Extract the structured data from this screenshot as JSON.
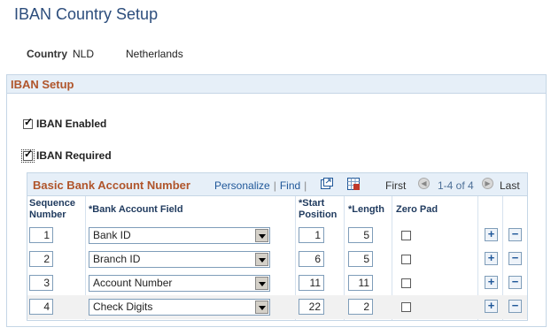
{
  "page": {
    "title": "IBAN Country Setup"
  },
  "country": {
    "label": "Country",
    "code": "NLD",
    "name": "Netherlands"
  },
  "iban_setup": {
    "title": "IBAN Setup",
    "iban_enabled": {
      "label": "IBAN Enabled",
      "checked": true
    },
    "iban_required": {
      "label": "IBAN Required",
      "checked": true
    }
  },
  "grid": {
    "title": "Basic Bank Account Number",
    "personalize": "Personalize",
    "find": "Find",
    "nav": {
      "first": "First",
      "range": "1-4 of 4",
      "last": "Last"
    },
    "columns": {
      "sequence_line1": "Sequence",
      "sequence_line2": "Number",
      "bank_account_field": "*Bank Account Field",
      "start_line1": "*Start",
      "start_line2": "Position",
      "length": "*Length",
      "zero_pad": "Zero Pad"
    },
    "rows": [
      {
        "seq": "1",
        "field": "Bank ID",
        "start": "1",
        "length": "5",
        "zero_pad": false
      },
      {
        "seq": "2",
        "field": "Branch ID",
        "start": "6",
        "length": "5",
        "zero_pad": false
      },
      {
        "seq": "3",
        "field": "Account Number",
        "start": "11",
        "length": "11",
        "zero_pad": false
      },
      {
        "seq": "4",
        "field": "Check Digits",
        "start": "22",
        "length": "2",
        "zero_pad": false
      }
    ],
    "add_symbol": "+",
    "delete_symbol": "−"
  },
  "icons": {
    "new_window": "new-window-icon",
    "download": "download-grid-icon",
    "first_arrow": "first-arrow-icon",
    "last_arrow": "last-arrow-icon",
    "dropdown": "chevron-down-icon"
  },
  "colors": {
    "title": "#2c4d7c",
    "section_title": "#b0552b",
    "link": "#1f5799",
    "header_bg": "#e6eff8"
  }
}
